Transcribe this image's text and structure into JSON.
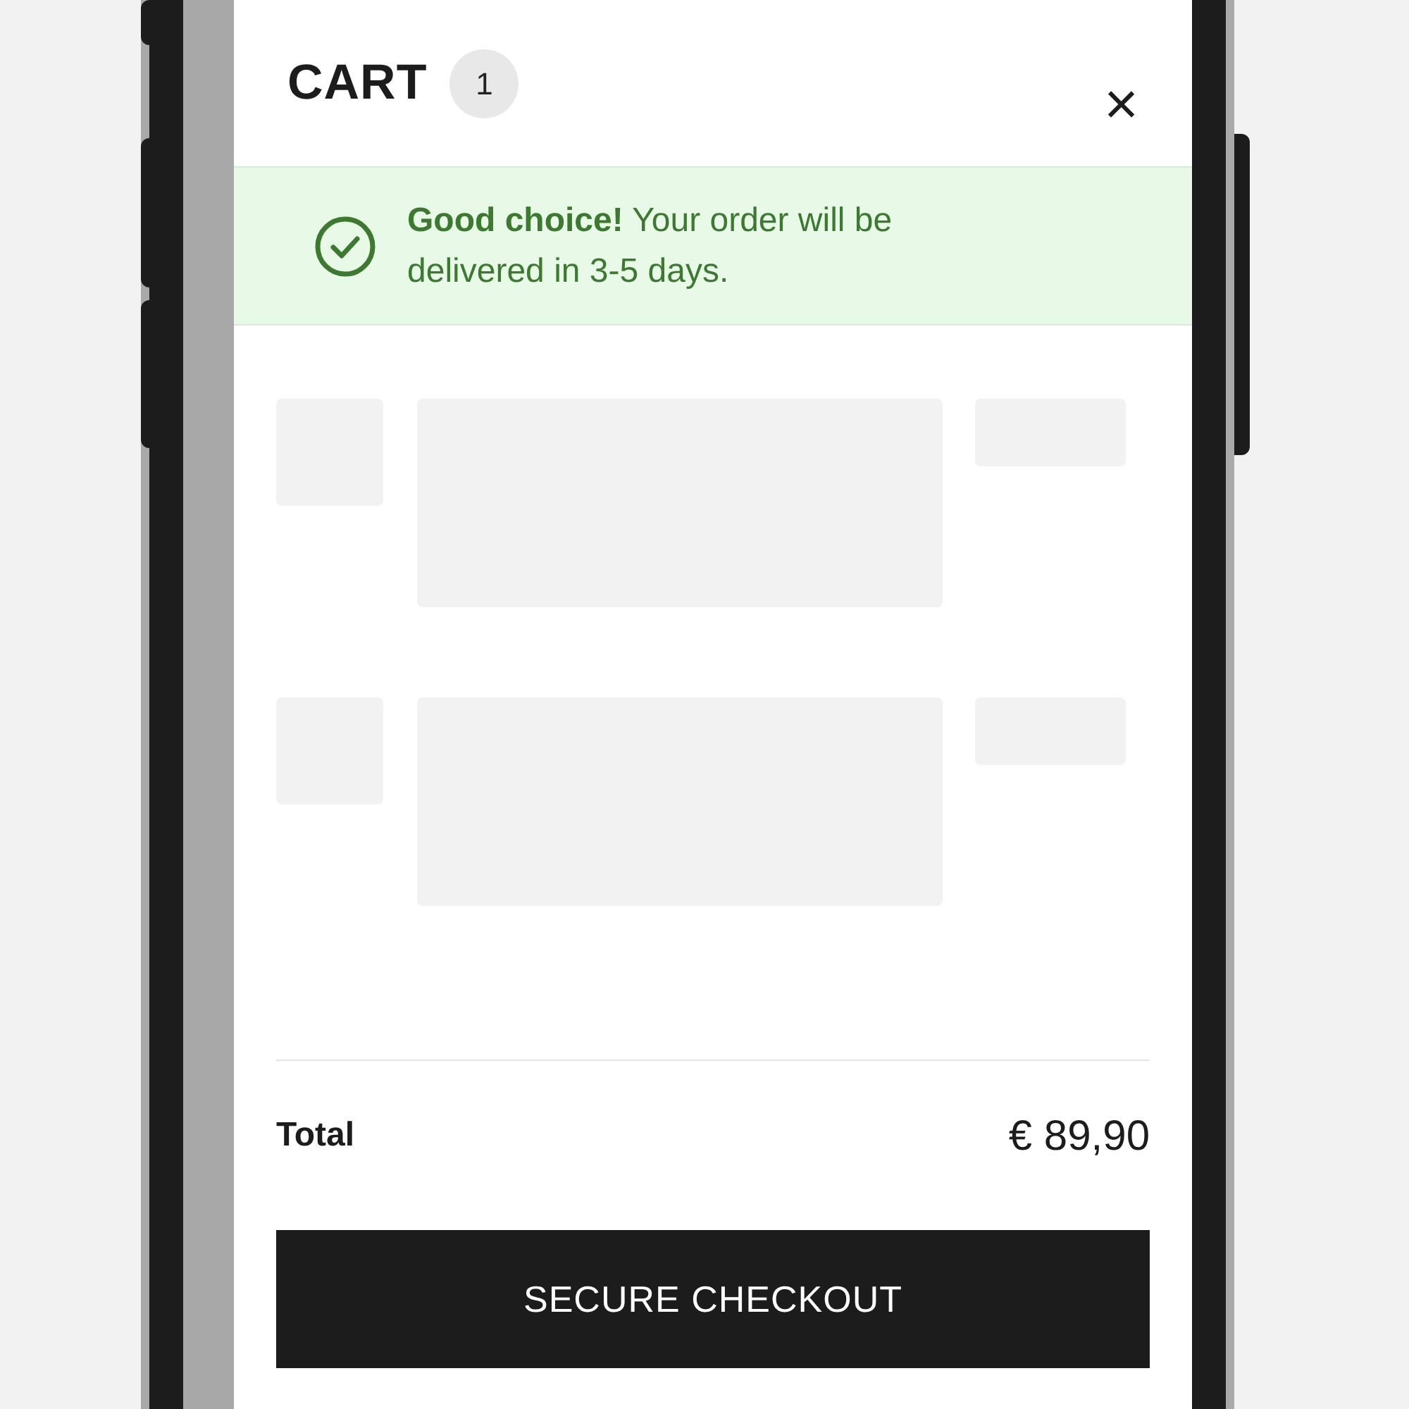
{
  "cart": {
    "title": "CART",
    "count": "1",
    "close": "×"
  },
  "notice": {
    "text": "**Good choice!** Your order will be delivered in 3-5 days."
  },
  "items": [
    {
      "kind": "skeleton"
    },
    {
      "kind": "skeleton"
    }
  ],
  "summary": {
    "label": "Total",
    "value": "€ 89,90"
  },
  "checkout": {
    "label": "SECURE CHECKOUT"
  }
}
